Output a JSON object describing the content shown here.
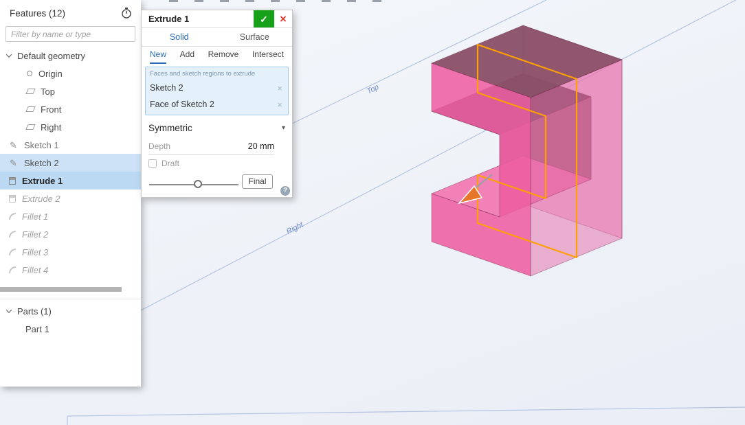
{
  "features_panel": {
    "title": "Features (12)",
    "filter_placeholder": "Filter by name or type",
    "tree": [
      {
        "label": "Default geometry",
        "state": "expanded"
      },
      {
        "label": "Origin",
        "state": "normal"
      },
      {
        "label": "Top",
        "state": "normal"
      },
      {
        "label": "Front",
        "state": "normal"
      },
      {
        "label": "Right",
        "state": "normal"
      },
      {
        "label": "Sketch 1",
        "state": "normal"
      },
      {
        "label": "Sketch 2",
        "state": "selected"
      },
      {
        "label": "Extrude 1",
        "state": "selected-active"
      },
      {
        "label": "Extrude 2",
        "state": "suppressed"
      },
      {
        "label": "Fillet 1",
        "state": "suppressed"
      },
      {
        "label": "Fillet 2",
        "state": "suppressed"
      },
      {
        "label": "Fillet 3",
        "state": "suppressed"
      },
      {
        "label": "Fillet 4",
        "state": "suppressed"
      }
    ],
    "parts_title": "Parts (1)",
    "parts": [
      {
        "label": "Part 1"
      }
    ]
  },
  "dialog": {
    "title": "Extrude 1",
    "tabs": [
      {
        "label": "Solid",
        "active": true
      },
      {
        "label": "Surface",
        "active": false
      }
    ],
    "modes": [
      {
        "label": "New",
        "active": true
      },
      {
        "label": "Add"
      },
      {
        "label": "Remove"
      },
      {
        "label": "Intersect"
      }
    ],
    "selection_caption": "Faces and sketch regions to extrude",
    "selections": [
      {
        "label": "Sketch 2"
      },
      {
        "label": "Face of Sketch 2"
      }
    ],
    "end_condition": "Symmetric",
    "depth_label": "Depth",
    "depth_value": "20 mm",
    "draft_label": "Draft",
    "final_label": "Final",
    "icons": {
      "confirm": "✓",
      "cancel": "×",
      "remove_item": "×",
      "caret": "▾",
      "help": "?"
    }
  },
  "viewport": {
    "plane_labels": {
      "top": "Top",
      "right": "Right"
    },
    "colors": {
      "accent_blue": "#2a6db5",
      "selection_fill": "#cde2f6",
      "selection_fill_strong": "#bcd9f3",
      "selection_box_bg": "#e4f0fa",
      "confirm_green": "#17a11b",
      "cancel_red": "#e23c2e",
      "sketch_orange": "#ffa000",
      "part_front": "#ee5fa3",
      "part_top": "#8a5168",
      "part_right": "#e569a8",
      "part_inner_dark": "#6f4356",
      "part_inner_wall": "#a15671",
      "part_floor": "#f07ab2",
      "part_back": "#ef83b6",
      "plane_line": "#b6c3e0",
      "plane_label": "#6b86ce",
      "manipulator_orange": "#e8762a"
    }
  }
}
